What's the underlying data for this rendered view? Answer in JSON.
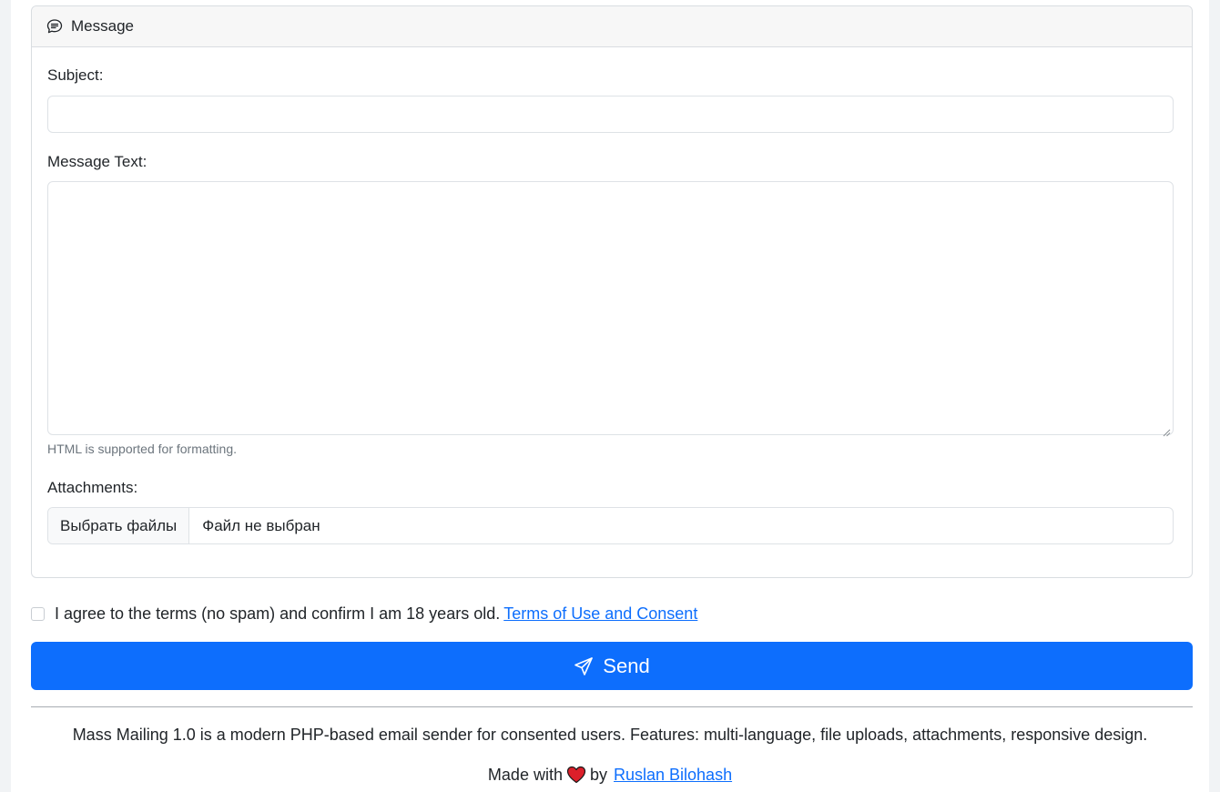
{
  "card": {
    "header_title": "Message",
    "subject_label": "Subject:",
    "subject_value": "",
    "message_label": "Message Text:",
    "message_value": "",
    "hint": "HTML is supported for formatting.",
    "attachments_label": "Attachments:",
    "file_button_label": "Выбрать файлы",
    "file_status": "Файл не выбран"
  },
  "consent": {
    "text": "I agree to the terms (no spam) and confirm I am 18 years old.",
    "link_text": "Terms of Use and Consent",
    "checked": false
  },
  "send_button": {
    "label": "Send"
  },
  "footer": {
    "description": "Mass Mailing 1.0 is a modern PHP-based email sender for consented users. Features: multi-language, file uploads, attachments, responsive design.",
    "made_with": "Made with",
    "by": "by",
    "author": "Ruslan Bilohash"
  },
  "colors": {
    "primary": "#0d6efd",
    "heart": "#dc1f2a"
  },
  "icons": {
    "header": "chat-square-text-icon",
    "send": "send-icon",
    "heart": "heart-icon"
  }
}
